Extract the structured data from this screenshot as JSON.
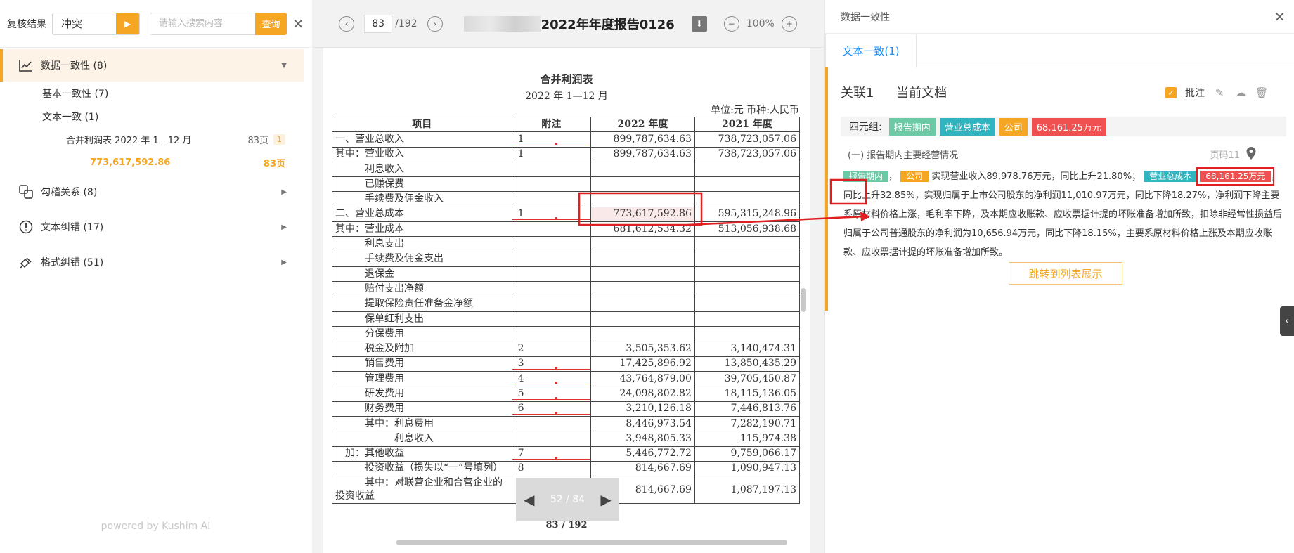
{
  "left": {
    "title": "复核结果",
    "filter_value": "冲突",
    "search_placeholder": "请输入搜索内容",
    "query_label": "查询",
    "nav": {
      "data_consistency": "数据一致性  (8)",
      "basic_consistency": "基本一致性  (7)",
      "text_consistency": "文本一致  (1)",
      "doc_item": "合并利润表 2022 年 1—12 月",
      "doc_item_page": "83页",
      "doc_item_badge": "1",
      "value_item": "773,617,592.86",
      "value_item_page": "83页",
      "check_relation": "勾稽关系  (8)",
      "text_error": "文本纠错  (17)",
      "format_error": "格式纠错  (51)"
    },
    "powered": "powered by Kushim AI"
  },
  "viewer": {
    "page_current": "83",
    "page_total": "/192",
    "doc_title": "2022年年度报告0126",
    "zoom": "100%",
    "page_heading": "合并利润表",
    "page_period": "2022 年 1—12 月",
    "page_unit": "单位:元  币种:人民币",
    "table_headers": [
      "项目",
      "附注",
      "2022 年度",
      "2021 年度"
    ],
    "rows": [
      {
        "item": "一、营业总收入",
        "note": "1",
        "y2022": "899,787,634.63",
        "y2021": "738,723,057.06"
      },
      {
        "item": "其中：营业收入",
        "note": "1",
        "y2022": "899,787,634.63",
        "y2021": "738,723,057.06"
      },
      {
        "item": "　　　利息收入",
        "note": "",
        "y2022": "",
        "y2021": ""
      },
      {
        "item": "　　　已赚保费",
        "note": "",
        "y2022": "",
        "y2021": ""
      },
      {
        "item": "　　　手续费及佣金收入",
        "note": "",
        "y2022": "",
        "y2021": ""
      },
      {
        "item": "二、营业总成本",
        "note": "1",
        "y2022": "773,617,592.86",
        "y2021": "595,315,248.96"
      },
      {
        "item": "其中：营业成本",
        "note": "",
        "y2022": "681,612,534.32",
        "y2021": "513,056,938.68"
      },
      {
        "item": "　　　利息支出",
        "note": "",
        "y2022": "",
        "y2021": ""
      },
      {
        "item": "　　　手续费及佣金支出",
        "note": "",
        "y2022": "",
        "y2021": ""
      },
      {
        "item": "　　　退保金",
        "note": "",
        "y2022": "",
        "y2021": ""
      },
      {
        "item": "　　　赔付支出净额",
        "note": "",
        "y2022": "",
        "y2021": ""
      },
      {
        "item": "　　　提取保险责任准备金净额",
        "note": "",
        "y2022": "",
        "y2021": ""
      },
      {
        "item": "　　　保单红利支出",
        "note": "",
        "y2022": "",
        "y2021": ""
      },
      {
        "item": "　　　分保费用",
        "note": "",
        "y2022": "",
        "y2021": ""
      },
      {
        "item": "　　　税金及附加",
        "note": "2",
        "y2022": "3,505,353.62",
        "y2021": "3,140,474.31"
      },
      {
        "item": "　　　销售费用",
        "note": "3",
        "y2022": "17,425,896.92",
        "y2021": "13,850,435.29"
      },
      {
        "item": "　　　管理费用",
        "note": "4",
        "y2022": "43,764,879.00",
        "y2021": "39,705,450.87"
      },
      {
        "item": "　　　研发费用",
        "note": "5",
        "y2022": "24,098,802.82",
        "y2021": "18,115,136.05"
      },
      {
        "item": "　　　财务费用",
        "note": "6",
        "y2022": "3,210,126.18",
        "y2021": "7,446,813.76"
      },
      {
        "item": "　　　其中：利息费用",
        "note": "",
        "y2022": "8,446,973.54",
        "y2021": "7,282,190.71"
      },
      {
        "item": "　　　　　　利息收入",
        "note": "",
        "y2022": "3,948,805.33",
        "y2021": "115,974.38"
      },
      {
        "item": "　加：其他收益",
        "note": "7",
        "y2022": "5,446,772.72",
        "y2021": "9,759,066.17"
      },
      {
        "item": "　　　投资收益（损失以“一”号填列）",
        "note": "8",
        "y2022": "814,667.69",
        "y2021": "1,090,947.13"
      },
      {
        "item": "　　　其中：对联营企业和合营企业的投资收益",
        "note": "",
        "y2022": "814,667.69",
        "y2021": "1,087,197.13"
      }
    ],
    "mini_nav": "52 / 84",
    "page_footer": "83 / 192"
  },
  "right": {
    "header": "数据一致性",
    "tab": "文本一致(1)",
    "card_title_a": "关联1",
    "card_title_b": "当前文档",
    "annotate_label": "批注",
    "quad_label": "四元组:",
    "tags": [
      "报告期内",
      "营业总成本",
      "公司",
      "68,161.25万元"
    ],
    "section": "(一) 报告期内主要经营情况",
    "section_page": "页码11",
    "para_tag1": "报告期内",
    "para_tag2": "公司",
    "para_text1": "实现营业收入89,978.76万元，同比上升21.80%；",
    "para_tag3": "营业总成本",
    "para_tag4": "68,161.25万元",
    "para_text2": "，同比上升32.85%，实现归属于上市公司股东的净利润11,010.97万元，同比下降18.27%，净利润下降主要系原材料价格上涨，毛利率下降，及本期应收账款、应收票据计提的坏账准备增加所致，扣除非经常性损益后归属于公司普通股东的净利润为10,656.94万元，同比下降18.15%，主要系原材料价格上涨及本期应收账款、应收票据计提的坏账准备增加所致。",
    "jump_label": "跳转到列表展示"
  }
}
